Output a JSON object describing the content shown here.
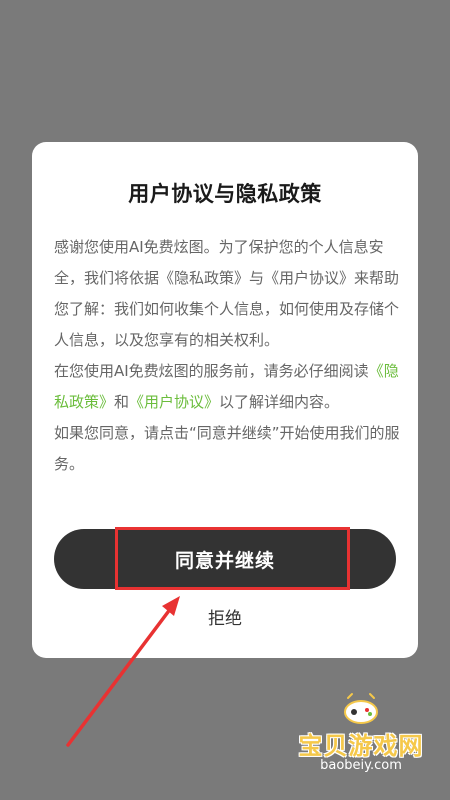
{
  "dialog": {
    "title": "用户协议与隐私政策",
    "paragraph1": "感谢您使用AI免费炫图。为了保护您的个人信息安全，我们将依据《隐私政策》与《用户协议》来帮助您了解：我们如何收集个人信息，如何使用及存储个人信息，以及您享有的相关权利。",
    "paragraph2_prefix": "在您使用AI免费炫图的服务前，请务必仔细阅读",
    "privacy_link": "《隐私政策》",
    "paragraph2_and": "和",
    "user_agreement_link": "《用户协议》",
    "paragraph2_suffix": "以了解详细内容。",
    "paragraph3": "如果您同意，请点击“同意并继续”开始使用我们的服务。",
    "agree_button": "同意并继续",
    "reject_button": "拒绝"
  },
  "watermark": {
    "title": "宝贝游戏网",
    "url": "baobeiy.com",
    "icon": "gamepad-icon"
  },
  "colors": {
    "overlay": "#7a7a7a",
    "link": "#6bbd3c",
    "button": "#333333",
    "highlight": "#e83232"
  }
}
